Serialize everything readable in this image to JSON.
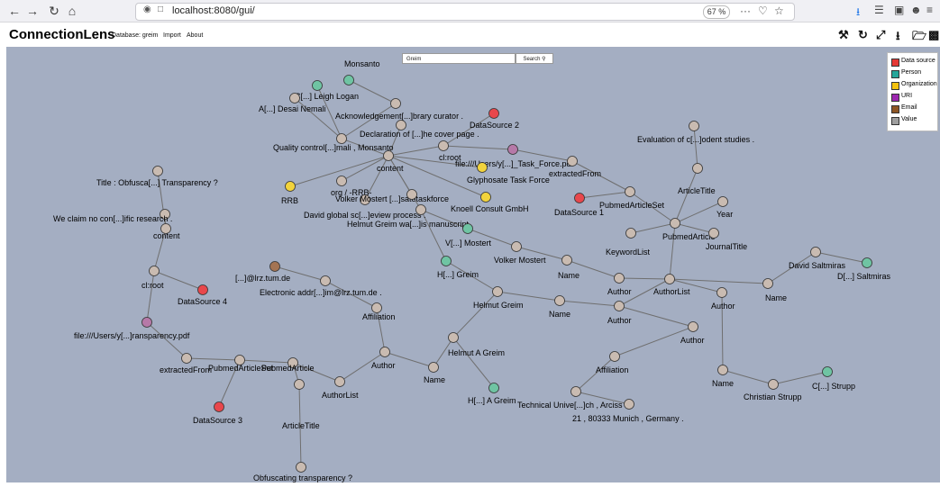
{
  "browser": {
    "url": "localhost:8080/gui/",
    "zoom": "67 %",
    "menu_dots": "···"
  },
  "app": {
    "title": "ConnectionLens",
    "menu": [
      "Database: greim",
      "Import",
      "About"
    ]
  },
  "search": {
    "value": "Greim",
    "button_label": "Search"
  },
  "legend": [
    {
      "label": "Data source",
      "color": "#e53935"
    },
    {
      "label": "Person",
      "color": "#26a69a"
    },
    {
      "label": "Organization",
      "color": "#f4c20d"
    },
    {
      "label": "URI",
      "color": "#9c27b0"
    },
    {
      "label": "Email",
      "color": "#8d5524"
    },
    {
      "label": "Value",
      "color": "#9e9e9e"
    }
  ],
  "colors": {
    "value_node": "#c9bbb1",
    "datasource_node": "#e8474c",
    "person_node": "#6fc4a3",
    "organization_node": "#f2d33c",
    "uri_node": "#b679a8",
    "email_node": "#a47453",
    "edge": "#6f6f6f"
  },
  "graph": {
    "nodes": [
      {
        "label": "Monsanto",
        "kind": "person"
      },
      {
        "label": "C[...] Leigh Logan",
        "kind": "person"
      },
      {
        "label": "A[...] Desai Nemali",
        "kind": "value"
      },
      {
        "label": "Acknowledgement[...]brary curator .",
        "kind": "value"
      },
      {
        "label": "DataSource 2",
        "kind": "datasource"
      },
      {
        "label": "Declaration of [...]he cover page .",
        "kind": "value"
      },
      {
        "label": "Quality control[...]mali , Monsanto",
        "kind": "value"
      },
      {
        "label": "cl:root",
        "kind": "value"
      },
      {
        "label": "file:///Users/y[...]_Task_Force.pdf",
        "kind": "uri"
      },
      {
        "label": "content",
        "kind": "value"
      },
      {
        "label": "Glyphosate Task Force",
        "kind": "organization"
      },
      {
        "label": "extractedFrom",
        "kind": "value"
      },
      {
        "label": "RRB",
        "kind": "organization"
      },
      {
        "label": "org / -RRB-",
        "kind": "value"
      },
      {
        "label": "Volker Mostert [...]satetaskforce",
        "kind": "value"
      },
      {
        "label": "Knoell Consult GmbH",
        "kind": "organization"
      },
      {
        "label": "David global sc[...]eview process .",
        "kind": "value"
      },
      {
        "label": "Helmut Greim wa[...]is manuscript .",
        "kind": "value"
      },
      {
        "label": "DataSource 1",
        "kind": "datasource"
      },
      {
        "label": "PubmedArticleSet",
        "kind": "value"
      },
      {
        "label": "Evaluation of c[...]odent studies .",
        "kind": "value"
      },
      {
        "label": "ArticleTitle",
        "kind": "value"
      },
      {
        "label": "Year",
        "kind": "value"
      },
      {
        "label": "PubmedArticle",
        "kind": "value"
      },
      {
        "label": "JournalTitle",
        "kind": "value"
      },
      {
        "label": "KeywordList",
        "kind": "value"
      },
      {
        "label": "V[...] Mostert",
        "kind": "person"
      },
      {
        "label": "Volker Mostert",
        "kind": "value"
      },
      {
        "label": "Name",
        "kind": "value"
      },
      {
        "label": "H[...] Greim",
        "kind": "person"
      },
      {
        "label": "Author",
        "kind": "value"
      },
      {
        "label": "AuthorList",
        "kind": "value"
      },
      {
        "label": "David Saltmiras",
        "kind": "value"
      },
      {
        "label": "D[...] Saltmiras",
        "kind": "person"
      },
      {
        "label": "Name",
        "kind": "value"
      },
      {
        "label": "Author",
        "kind": "value"
      },
      {
        "label": "Title : Obfusca[...] Transparency ?",
        "kind": "value"
      },
      {
        "label": "We claim no con[...]ific research .",
        "kind": "value"
      },
      {
        "label": "content",
        "kind": "value"
      },
      {
        "label": "cl:root",
        "kind": "value"
      },
      {
        "label": "DataSource 4",
        "kind": "datasource"
      },
      {
        "label": "[...]@lrz.tum.de",
        "kind": "email"
      },
      {
        "label": "Electronic addr[...]im@lrz.tum.de .",
        "kind": "value"
      },
      {
        "label": "Affiliation",
        "kind": "value"
      },
      {
        "label": "Helmut Greim",
        "kind": "value"
      },
      {
        "label": "Name",
        "kind": "value"
      },
      {
        "label": "Author",
        "kind": "value"
      },
      {
        "label": "Author",
        "kind": "value"
      },
      {
        "label": "file:///Users/y[...]ransparency.pdf",
        "kind": "uri"
      },
      {
        "label": "Helmut A Greim",
        "kind": "value"
      },
      {
        "label": "extractedFrom",
        "kind": "value"
      },
      {
        "label": "PubmedArticleSet",
        "kind": "value"
      },
      {
        "label": "PubmedArticle",
        "kind": "value"
      },
      {
        "label": "Author",
        "kind": "value"
      },
      {
        "label": "AuthorList",
        "kind": "value"
      },
      {
        "label": "Name",
        "kind": "value"
      },
      {
        "label": "Affiliation",
        "kind": "value"
      },
      {
        "label": "Name",
        "kind": "value"
      },
      {
        "label": "Christian Strupp",
        "kind": "value"
      },
      {
        "label": "C[...] Strupp",
        "kind": "person"
      },
      {
        "label": "H[...] A Greim",
        "kind": "person"
      },
      {
        "label": "Technical Unive[...]ch , Arciss",
        "kind": "value"
      },
      {
        "label": "21 , 80333 Munich , Germany .",
        "kind": "value"
      },
      {
        "label": "DataSource 3",
        "kind": "datasource"
      },
      {
        "label": "ArticleTitle",
        "kind": "value"
      },
      {
        "label": "Obfuscating transparency ?",
        "kind": "value"
      }
    ]
  }
}
